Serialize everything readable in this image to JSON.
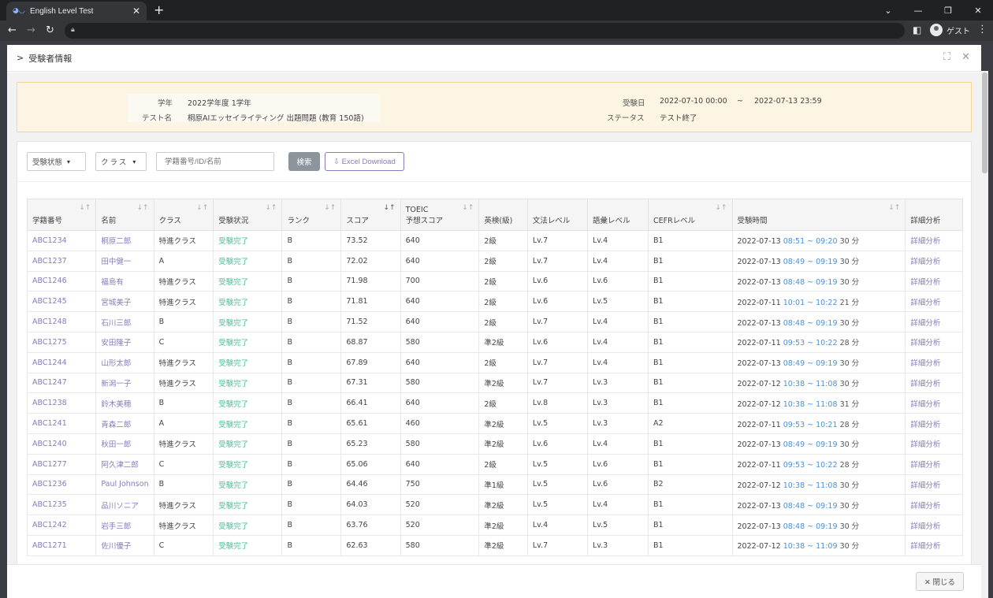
{
  "browser": {
    "tab_title": "English Level Test",
    "tab_close": "✕",
    "new_tab": "+",
    "profile_name": "ゲスト"
  },
  "modal": {
    "title": "受験者情報",
    "close_label": "✕ 閉じる"
  },
  "info": {
    "grade_label": "学年",
    "grade_value": "2022学年度 1学年",
    "test_name_label": "テスト名",
    "test_name_value": "桐原AIエッセイライティング 出題問題 (教育 150語)",
    "exam_date_label": "受験日",
    "exam_date_start": "2022-07-10  00:00",
    "exam_date_sep": "~",
    "exam_date_end": "2022-07-13  23:59",
    "status_label": "ステータス",
    "status_value": "テスト終了"
  },
  "filters": {
    "status_select": "受験状態",
    "class_select": "クラス",
    "search_placeholder": "学籍番号/ID/名前",
    "search_button": "検索",
    "excel_button": "Excel Download"
  },
  "table": {
    "headers": {
      "student_id": "学籍番号",
      "name": "名前",
      "class": "クラス",
      "status": "受験状況",
      "rank": "ランク",
      "score": "スコア",
      "toeic_top": "TOEIC",
      "toeic_bottom": "予想スコア",
      "eiken": "英検(級)",
      "grammar": "文法レベル",
      "vocab": "語彙レベル",
      "cefr": "CEFRレベル",
      "exam_time": "受験時間",
      "detail": "詳細分析"
    },
    "rows": [
      {
        "id": "ABC1234",
        "name": "桐原二郎",
        "cls": "特進クラス",
        "status": "受験完了",
        "rank": "B",
        "score": "73.52",
        "toeic": "640",
        "eiken": "2級",
        "grammar": "Lv.7",
        "vocab": "Lv.4",
        "cefr": "B1",
        "date": "2022-07-13",
        "time": "08:51 ~ 09:20",
        "dur": "30 分",
        "detail": "詳細分析"
      },
      {
        "id": "ABC1237",
        "name": "田中健一",
        "cls": "A",
        "status": "受験完了",
        "rank": "B",
        "score": "72.02",
        "toeic": "640",
        "eiken": "2級",
        "grammar": "Lv.7",
        "vocab": "Lv.4",
        "cefr": "B1",
        "date": "2022-07-13",
        "time": "08:49 ~ 09:19",
        "dur": "30 分",
        "detail": "詳細分析"
      },
      {
        "id": "ABC1246",
        "name": "福島有",
        "cls": "特進クラス",
        "status": "受験完了",
        "rank": "B",
        "score": "71.98",
        "toeic": "700",
        "eiken": "2級",
        "grammar": "Lv.6",
        "vocab": "Lv.6",
        "cefr": "B1",
        "date": "2022-07-13",
        "time": "08:48 ~ 09:19",
        "dur": "30 分",
        "detail": "詳細分析"
      },
      {
        "id": "ABC1245",
        "name": "宮城美子",
        "cls": "特進クラス",
        "status": "受験完了",
        "rank": "B",
        "score": "71.81",
        "toeic": "640",
        "eiken": "2級",
        "grammar": "Lv.6",
        "vocab": "Lv.5",
        "cefr": "B1",
        "date": "2022-07-11",
        "time": "10:01 ~ 10:22",
        "dur": "21 分",
        "detail": "詳細分析"
      },
      {
        "id": "ABC1248",
        "name": "石川三郎",
        "cls": "B",
        "status": "受験完了",
        "rank": "B",
        "score": "71.52",
        "toeic": "640",
        "eiken": "2級",
        "grammar": "Lv.7",
        "vocab": "Lv.4",
        "cefr": "B1",
        "date": "2022-07-13",
        "time": "08:48 ~ 09:19",
        "dur": "30 分",
        "detail": "詳細分析"
      },
      {
        "id": "ABC1275",
        "name": "安田隆子",
        "cls": "C",
        "status": "受験完了",
        "rank": "B",
        "score": "68.87",
        "toeic": "580",
        "eiken": "準2級",
        "grammar": "Lv.6",
        "vocab": "Lv.4",
        "cefr": "B1",
        "date": "2022-07-11",
        "time": "09:53 ~ 10:22",
        "dur": "28 分",
        "detail": "詳細分析"
      },
      {
        "id": "ABC1244",
        "name": "山形太郎",
        "cls": "特進クラス",
        "status": "受験完了",
        "rank": "B",
        "score": "67.89",
        "toeic": "640",
        "eiken": "2級",
        "grammar": "Lv.7",
        "vocab": "Lv.4",
        "cefr": "B1",
        "date": "2022-07-13",
        "time": "08:49 ~ 09:19",
        "dur": "30 分",
        "detail": "詳細分析"
      },
      {
        "id": "ABC1247",
        "name": "新潟一子",
        "cls": "特進クラス",
        "status": "受験完了",
        "rank": "B",
        "score": "67.31",
        "toeic": "580",
        "eiken": "準2級",
        "grammar": "Lv.7",
        "vocab": "Lv.3",
        "cefr": "B1",
        "date": "2022-07-12",
        "time": "10:38 ~ 11:08",
        "dur": "30 分",
        "detail": "詳細分析"
      },
      {
        "id": "ABC1238",
        "name": "鈴木美穂",
        "cls": "B",
        "status": "受験完了",
        "rank": "B",
        "score": "66.41",
        "toeic": "640",
        "eiken": "2級",
        "grammar": "Lv.8",
        "vocab": "Lv.3",
        "cefr": "B1",
        "date": "2022-07-12",
        "time": "10:38 ~ 11:08",
        "dur": "31 分",
        "detail": "詳細分析"
      },
      {
        "id": "ABC1241",
        "name": "青森二郎",
        "cls": "A",
        "status": "受験完了",
        "rank": "B",
        "score": "65.61",
        "toeic": "460",
        "eiken": "準2級",
        "grammar": "Lv.5",
        "vocab": "Lv.3",
        "cefr": "A2",
        "date": "2022-07-11",
        "time": "09:53 ~ 10:21",
        "dur": "28 分",
        "detail": "詳細分析"
      },
      {
        "id": "ABC1240",
        "name": "秋田一郎",
        "cls": "特進クラス",
        "status": "受験完了",
        "rank": "B",
        "score": "65.23",
        "toeic": "580",
        "eiken": "準2級",
        "grammar": "Lv.6",
        "vocab": "Lv.4",
        "cefr": "B1",
        "date": "2022-07-13",
        "time": "08:49 ~ 09:19",
        "dur": "30 分",
        "detail": "詳細分析"
      },
      {
        "id": "ABC1277",
        "name": "阿久津二郎",
        "cls": "C",
        "status": "受験完了",
        "rank": "B",
        "score": "65.06",
        "toeic": "640",
        "eiken": "2級",
        "grammar": "Lv.5",
        "vocab": "Lv.6",
        "cefr": "B1",
        "date": "2022-07-11",
        "time": "09:53 ~ 10:22",
        "dur": "28 分",
        "detail": "詳細分析"
      },
      {
        "id": "ABC1236",
        "name": "Paul Johnson",
        "cls": "B",
        "status": "受験完了",
        "rank": "B",
        "score": "64.46",
        "toeic": "750",
        "eiken": "準1級",
        "grammar": "Lv.5",
        "vocab": "Lv.6",
        "cefr": "B2",
        "date": "2022-07-12",
        "time": "10:38 ~ 11:08",
        "dur": "30 分",
        "detail": "詳細分析"
      },
      {
        "id": "ABC1235",
        "name": "品川ソニア",
        "cls": "特進クラス",
        "status": "受験完了",
        "rank": "B",
        "score": "64.03",
        "toeic": "520",
        "eiken": "準2級",
        "grammar": "Lv.5",
        "vocab": "Lv.4",
        "cefr": "B1",
        "date": "2022-07-13",
        "time": "08:48 ~ 09:19",
        "dur": "30 分",
        "detail": "詳細分析"
      },
      {
        "id": "ABC1242",
        "name": "岩手三郎",
        "cls": "特進クラス",
        "status": "受験完了",
        "rank": "B",
        "score": "63.76",
        "toeic": "520",
        "eiken": "準2級",
        "grammar": "Lv.4",
        "vocab": "Lv.5",
        "cefr": "B1",
        "date": "2022-07-13",
        "time": "08:48 ~ 09:19",
        "dur": "30 分",
        "detail": "詳細分析"
      },
      {
        "id": "ABC1271",
        "name": "佐川優子",
        "cls": "C",
        "status": "受験完了",
        "rank": "B",
        "score": "62.63",
        "toeic": "580",
        "eiken": "準2級",
        "grammar": "Lv.7",
        "vocab": "Lv.3",
        "cefr": "B1",
        "date": "2022-07-12",
        "time": "10:38 ~ 11:09",
        "dur": "30 分",
        "detail": "詳細分析"
      }
    ]
  },
  "colors": {
    "link": "#8a7ab8",
    "status_complete": "#4bbf9a",
    "time": "#4a90d9",
    "info_bg": "#fdf5e3"
  }
}
